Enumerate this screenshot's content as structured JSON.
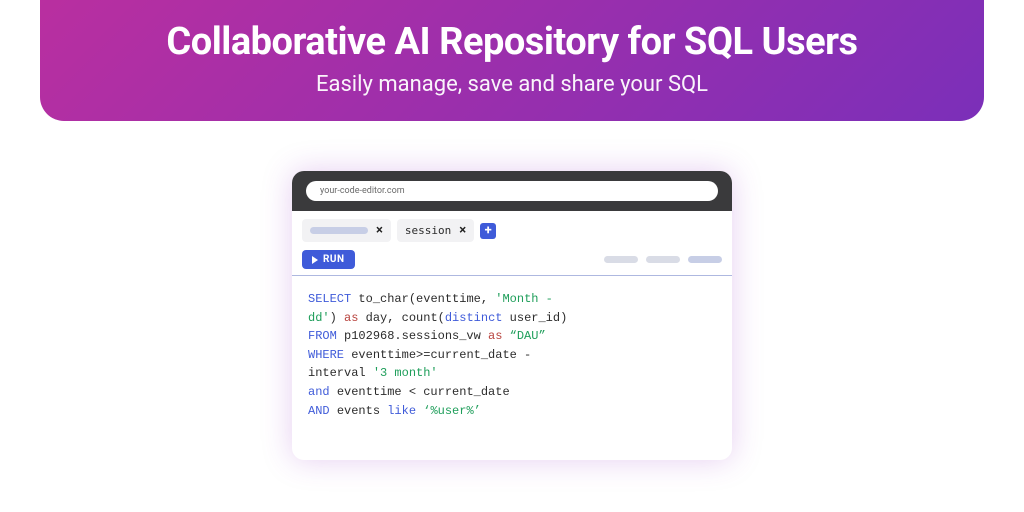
{
  "hero": {
    "title": "Collaborative AI Repository for SQL Users",
    "subtitle": "Easily manage, save and share your SQL"
  },
  "browser": {
    "url": "your-code-editor.com"
  },
  "tabs": {
    "tab1_close": "×",
    "tab2_label": "session",
    "tab2_close": "×",
    "add_label": "+"
  },
  "toolbar": {
    "run_label": "RUN"
  },
  "code": {
    "kw_select": "SELECT",
    "fn_tochar": "to_char",
    "lp1": "(",
    "id_eventtime1": "eventtime",
    "comma1": ", ",
    "str_month": "'Month -\ndd'",
    "rp1": ")",
    "as1": " as ",
    "id_day": "day",
    "comma2": ", ",
    "fn_count": "count",
    "lp2": "(",
    "kw_distinct": "distinct",
    "sp1": " ",
    "id_userid": "user_id",
    "rp2": ")",
    "kw_from": "FROM",
    "sp2": " ",
    "id_table": "p102968.sessions_vw",
    "as2": " as ",
    "str_dau": "“DAU”",
    "kw_where": "WHERE",
    "sp3": " ",
    "id_eventtime2": "eventtime",
    "op_gte": ">=",
    "id_curdate1": "current_date",
    "op_minus1": " -\n",
    "id_interval": "interval",
    "sp4": " ",
    "str_3month": "'3 month'",
    "kw_and1": "and",
    "sp5": " ",
    "id_eventtime3": "eventtime",
    "op_lt": " < ",
    "id_curdate2": "current_date",
    "kw_and2": "AND",
    "sp6": " ",
    "id_events": "events",
    "sp7": " ",
    "kw_like": "like",
    "sp8": " ",
    "str_user": "‘%user%’"
  }
}
